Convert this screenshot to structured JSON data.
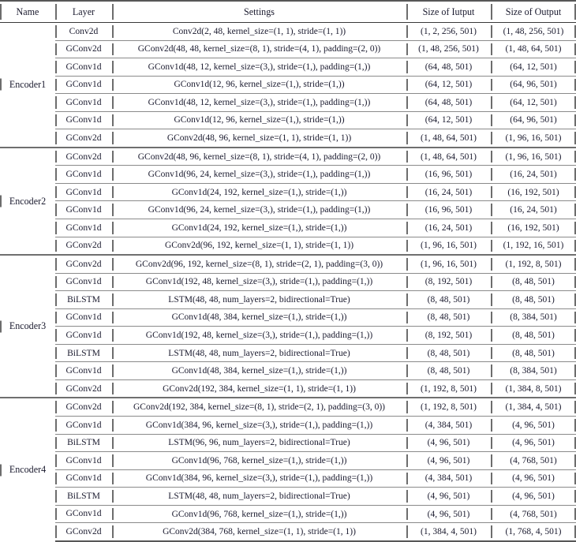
{
  "table": {
    "columns": [
      {
        "key": "name",
        "label": "Name"
      },
      {
        "key": "layer",
        "label": "Layer"
      },
      {
        "key": "settings",
        "label": "Settings"
      },
      {
        "key": "input",
        "label": "Size of Iutput"
      },
      {
        "key": "output",
        "label": "Size of Output"
      }
    ],
    "groups": [
      {
        "name": "Encoder1",
        "rows": [
          {
            "layer": "Conv2d",
            "settings": "Conv2d(2, 48, kernel_size=(1, 1), stride=(1, 1))",
            "input": "(1, 2, 256, 501)",
            "output": "(1, 48, 256, 501)"
          },
          {
            "layer": "GConv2d",
            "settings": "GConv2d(48, 48, kernel_size=(8, 1), stride=(4, 1), padding=(2, 0))",
            "input": "(1, 48, 256, 501)",
            "output": "(1, 48, 64, 501)"
          },
          {
            "layer": "GConv1d",
            "settings": "GConv1d(48, 12, kernel_size=(3,), stride=(1,), padding=(1,))",
            "input": "(64, 48, 501)",
            "output": "(64, 12, 501)"
          },
          {
            "layer": "GConv1d",
            "settings": "GConv1d(12, 96, kernel_size=(1,), stride=(1,))",
            "input": "(64, 12, 501)",
            "output": "(64, 96, 501)"
          },
          {
            "layer": "GConv1d",
            "settings": "GConv1d(48, 12, kernel_size=(3,), stride=(1,), padding=(1,))",
            "input": "(64, 48, 501)",
            "output": "(64, 12, 501)"
          },
          {
            "layer": "GConv1d",
            "settings": "GConv1d(12, 96, kernel_size=(1,), stride=(1,))",
            "input": "(64, 12, 501)",
            "output": "(64, 96, 501)"
          },
          {
            "layer": "GConv2d",
            "settings": "GConv2d(48, 96, kernel_size=(1, 1), stride=(1, 1))",
            "input": "(1, 48, 64, 501)",
            "output": "(1, 96, 16, 501)"
          }
        ]
      },
      {
        "name": "Encoder2",
        "rows": [
          {
            "layer": "GConv2d",
            "settings": "GConv2d(48, 96, kernel_size=(8, 1), stride=(4, 1), padding=(2, 0))",
            "input": "(1, 48, 64, 501)",
            "output": "(1, 96, 16, 501)"
          },
          {
            "layer": "GConv1d",
            "settings": "GConv1d(96, 24, kernel_size=(3,), stride=(1,), padding=(1,))",
            "input": "(16, 96, 501)",
            "output": "(16, 24, 501)"
          },
          {
            "layer": "GConv1d",
            "settings": "GConv1d(24, 192, kernel_size=(1,), stride=(1,))",
            "input": "(16, 24, 501)",
            "output": "(16, 192, 501)"
          },
          {
            "layer": "GConv1d",
            "settings": "GConv1d(96, 24, kernel_size=(3,), stride=(1,), padding=(1,))",
            "input": "(16, 96, 501)",
            "output": "(16, 24, 501)"
          },
          {
            "layer": "GConv1d",
            "settings": "GConv1d(24, 192, kernel_size=(1,), stride=(1,))",
            "input": "(16, 24, 501)",
            "output": "(16, 192, 501)"
          },
          {
            "layer": "GConv2d",
            "settings": "GConv2d(96, 192, kernel_size=(1, 1), stride=(1, 1))",
            "input": "(1, 96, 16, 501)",
            "output": "(1, 192, 16, 501)"
          }
        ]
      },
      {
        "name": "Encoder3",
        "rows": [
          {
            "layer": "GConv2d",
            "settings": "GConv2d(96, 192, kernel_size=(8, 1), stride=(2, 1), padding=(3, 0))",
            "input": "(1, 96, 16, 501)",
            "output": "(1, 192, 8, 501)"
          },
          {
            "layer": "GConv1d",
            "settings": "GConv1d(192, 48, kernel_size=(3,), stride=(1,), padding=(1,))",
            "input": "(8, 192, 501)",
            "output": "(8, 48, 501)"
          },
          {
            "layer": "BiLSTM",
            "settings": "LSTM(48, 48, num_layers=2, bidirectional=True)",
            "input": "(8, 48, 501)",
            "output": "(8, 48, 501)"
          },
          {
            "layer": "GConv1d",
            "settings": "GConv1d(48, 384, kernel_size=(1,), stride=(1,))",
            "input": "(8, 48, 501)",
            "output": "(8, 384, 501)"
          },
          {
            "layer": "GConv1d",
            "settings": "GConv1d(192, 48, kernel_size=(3,), stride=(1,), padding=(1,))",
            "input": "(8, 192, 501)",
            "output": "(8, 48, 501)"
          },
          {
            "layer": "BiLSTM",
            "settings": "LSTM(48, 48, num_layers=2, bidirectional=True)",
            "input": "(8, 48, 501)",
            "output": "(8, 48, 501)"
          },
          {
            "layer": "GConv1d",
            "settings": "GConv1d(48, 384, kernel_size=(1,), stride=(1,))",
            "input": "(8, 48, 501)",
            "output": "(8, 384, 501)"
          },
          {
            "layer": "GConv2d",
            "settings": "GConv2d(192, 384, kernel_size=(1, 1), stride=(1, 1))",
            "input": "(1, 192, 8, 501)",
            "output": "(1, 384, 8, 501)"
          }
        ]
      },
      {
        "name": "Encoder4",
        "rows": [
          {
            "layer": "GConv2d",
            "settings": "GConv2d(192, 384, kernel_size=(8, 1), stride=(2, 1), padding=(3, 0))",
            "input": "(1, 192, 8, 501)",
            "output": "(1, 384, 4, 501)"
          },
          {
            "layer": "GConv1d",
            "settings": "GConv1d(384, 96, kernel_size=(3,), stride=(1,), padding=(1,))",
            "input": "(4, 384, 501)",
            "output": "(4, 96, 501)"
          },
          {
            "layer": "BiLSTM",
            "settings": "LSTM(96, 96, num_layers=2, bidirectional=True)",
            "input": "(4, 96, 501)",
            "output": "(4, 96, 501)"
          },
          {
            "layer": "GConv1d",
            "settings": "GConv1d(96, 768, kernel_size=(1,), stride=(1,))",
            "input": "(4, 96, 501)",
            "output": "(4, 768, 501)"
          },
          {
            "layer": "GConv1d",
            "settings": "GConv1d(384, 96, kernel_size=(3,), stride=(1,), padding=(1,))",
            "input": "(4, 384, 501)",
            "output": "(4, 96, 501)"
          },
          {
            "layer": "BiLSTM",
            "settings": "LSTM(48, 48, num_layers=2, bidirectional=True)",
            "input": "(4, 96, 501)",
            "output": "(4, 96, 501)"
          },
          {
            "layer": "GConv1d",
            "settings": "GConv1d(96, 768, kernel_size=(1,), stride=(1,))",
            "input": "(4, 96, 501)",
            "output": "(4, 768, 501)"
          },
          {
            "layer": "GConv2d",
            "settings": "GConv2d(384, 768, kernel_size=(1, 1), stride=(1, 1))",
            "input": "(1, 384, 4, 501)",
            "output": "(1, 768, 4, 501)"
          }
        ]
      }
    ]
  }
}
